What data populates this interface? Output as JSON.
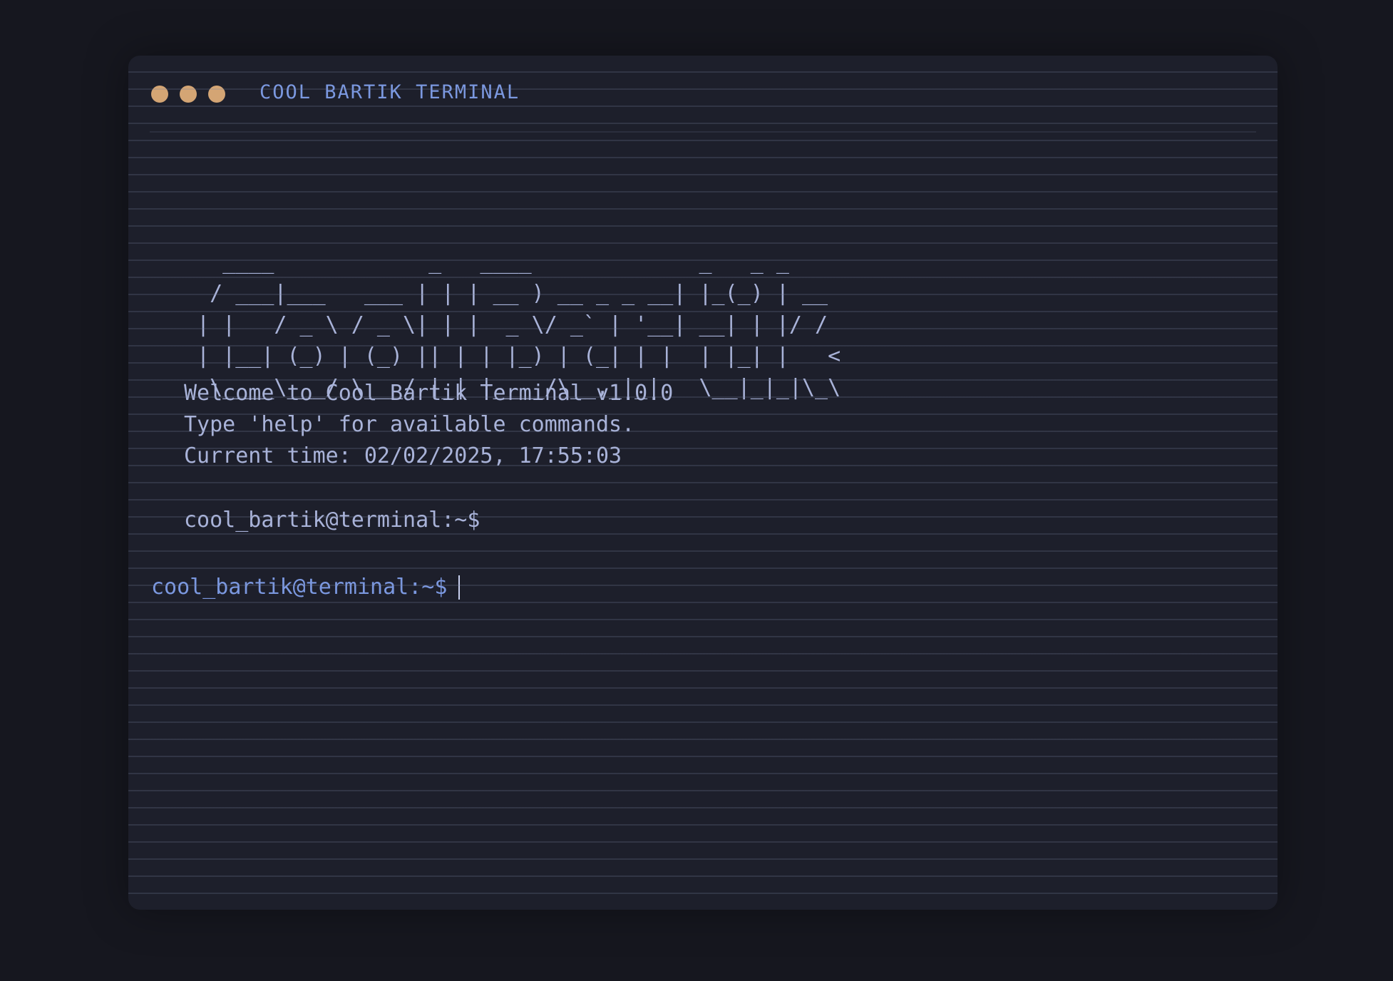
{
  "window": {
    "title": "COOL BARTIK TERMINAL",
    "controls": [
      "close-dot",
      "minimize-dot",
      "maximize-dot"
    ],
    "colors": {
      "dots": "#d4a574",
      "title": "#7b98e0",
      "text": "#a9b3d9",
      "background": "#1d1f2b"
    }
  },
  "banner": {
    "ascii": "   ____            _   ____             _   _ _\n  / ___|___   ___ | | | __ ) __ _ _ __| |_(_) | __\n | |   / _ \\ / _ \\| | |  _ \\/ _` | '__| __| | |/ /\n | |__| (_) | (_) || | | |_) | (_| | |  | |_| |   <\n  \\____\\___/ \\___/ |_| |____/\\__,_|_|   \\__|_|_|\\_\\"
  },
  "output": {
    "welcome": "Welcome to Cool Bartik Terminal v1.0.0",
    "help_hint": "Type 'help' for available commands.",
    "current_time": "Current time: 02/02/2025, 17:55:03",
    "previous_prompt": "cool_bartik@terminal:~$"
  },
  "input": {
    "prompt": "cool_bartik@terminal:~$",
    "value": ""
  }
}
